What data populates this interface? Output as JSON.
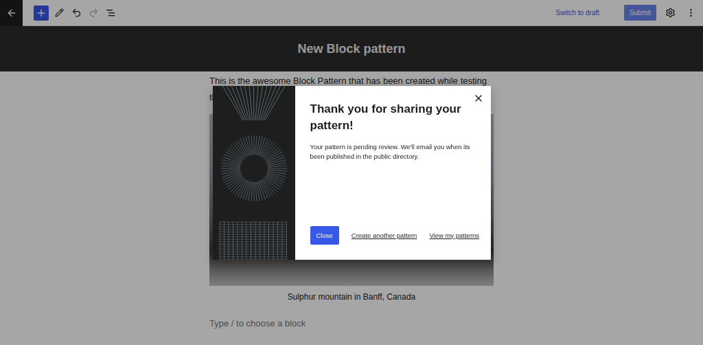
{
  "toolbar": {
    "inserter_active": true,
    "redo_disabled": true,
    "actions": [
      {
        "label": "Switch to draft",
        "kind": "link",
        "disabled": false
      },
      {
        "label": "Submit",
        "kind": "button",
        "disabled": true
      }
    ]
  },
  "editor": {
    "title": "New Block pattern",
    "paragraph_lines": [
      "This is the awesome Block Pattern that has been created while testing",
      "th"
    ],
    "image_caption": "Sulphur mountain in Banff, Canada",
    "placeholder": "Type / to choose a block"
  },
  "modal": {
    "title": "Thank you for sharing your pattern!",
    "message": "Your pattern is pending review. We'll email you when its been published in the public directory.",
    "buttons": [
      {
        "label": "Close",
        "kind": "primary"
      },
      {
        "label": "Create another pattern",
        "kind": "link"
      },
      {
        "label": "View my patterns",
        "kind": "link"
      }
    ]
  }
}
